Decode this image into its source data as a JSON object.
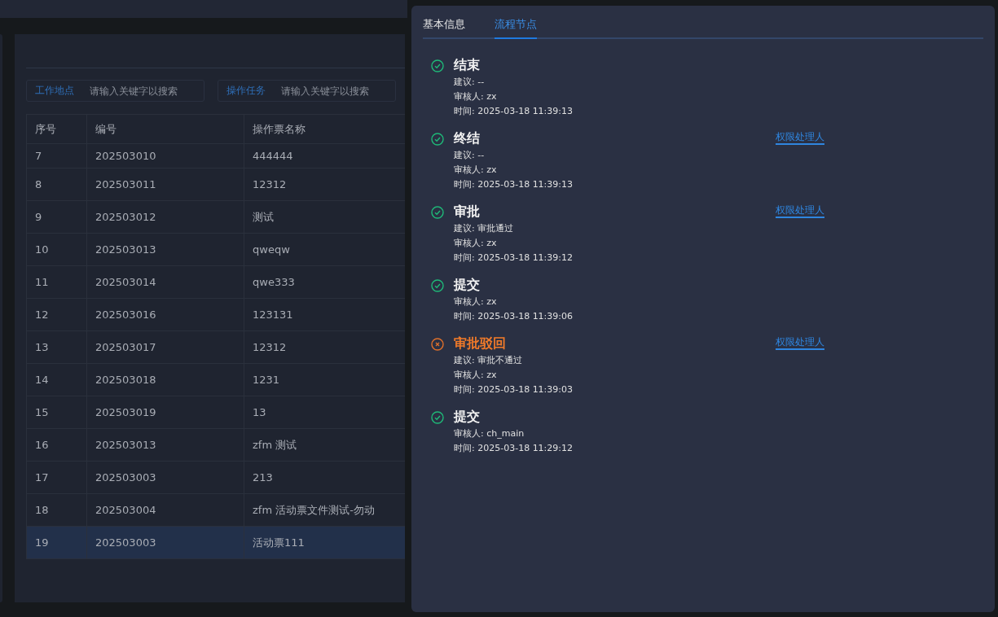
{
  "filters": [
    {
      "label": "工作地点",
      "placeholder": "请输入关键字以搜索"
    },
    {
      "label": "操作任务",
      "placeholder": "请输入关键字以搜索"
    }
  ],
  "table": {
    "columns": [
      "序号",
      "编号",
      "操作票名称"
    ],
    "rows": [
      {
        "cells": [
          "7",
          "202503010",
          "444444"
        ],
        "selected": false
      },
      {
        "cells": [
          "8",
          "202503011",
          "12312"
        ],
        "selected": false
      },
      {
        "cells": [
          "9",
          "202503012",
          "测试"
        ],
        "selected": false
      },
      {
        "cells": [
          "10",
          "202503013",
          "qweqw"
        ],
        "selected": false
      },
      {
        "cells": [
          "11",
          "202503014",
          "qwe333"
        ],
        "selected": false
      },
      {
        "cells": [
          "12",
          "202503016",
          "123131"
        ],
        "selected": false
      },
      {
        "cells": [
          "13",
          "202503017",
          "12312"
        ],
        "selected": false
      },
      {
        "cells": [
          "14",
          "202503018",
          "1231"
        ],
        "selected": false
      },
      {
        "cells": [
          "15",
          "202503019",
          "13"
        ],
        "selected": false
      },
      {
        "cells": [
          "16",
          "202503013",
          "zfm 测试"
        ],
        "selected": false
      },
      {
        "cells": [
          "17",
          "202503003",
          "213"
        ],
        "selected": false
      },
      {
        "cells": [
          "18",
          "202503004",
          "zfm 活动票文件测试-勿动"
        ],
        "selected": false
      },
      {
        "cells": [
          "19",
          "202503003",
          "活动票111"
        ],
        "selected": true
      }
    ]
  },
  "drawer": {
    "tabs": [
      {
        "label": "基本信息",
        "selected": false
      },
      {
        "label": "流程节点",
        "selected": true
      }
    ],
    "nodes": [
      {
        "kind": "done",
        "title": "结束",
        "lines": [
          "建议: --",
          "审核人: zx",
          "时间: 2025-03-18 11:39:13"
        ]
      },
      {
        "kind": "done",
        "title": "终结",
        "link": "权限处理人",
        "lines": [
          "建议: --",
          "审核人: zx",
          "时间: 2025-03-18 11:39:13"
        ]
      },
      {
        "kind": "done",
        "title": "审批",
        "link": "权限处理人",
        "lines": [
          "建议: 审批通过",
          "审核人: zx",
          "时间: 2025-03-18 11:39:12"
        ]
      },
      {
        "kind": "done",
        "title": "提交",
        "lines": [
          "审核人: zx",
          "时间: 2025-03-18 11:39:06"
        ]
      },
      {
        "kind": "rejected",
        "title": "审批驳回",
        "link": "权限处理人",
        "lines": [
          "建议: 审批不通过",
          "审核人: zx",
          "时间: 2025-03-18 11:39:03"
        ]
      },
      {
        "kind": "done",
        "title": "提交",
        "lines": [
          "审核人: ch_main",
          "时间: 2025-03-18 11:29:12"
        ]
      }
    ]
  }
}
